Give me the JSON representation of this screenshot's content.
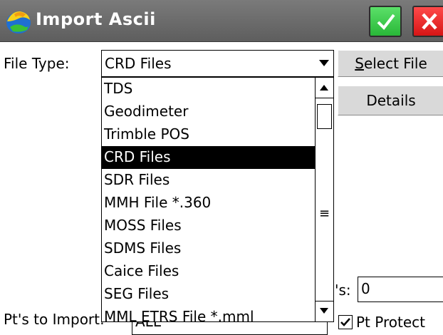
{
  "window": {
    "title": "Import Ascii"
  },
  "form": {
    "file_type_label": "File Type:",
    "file_type_value": "CRD Files",
    "select_file_prefix": "S",
    "select_file_rest": "elect File",
    "details_label": "Details",
    "pts_to_import_label": "Pt's to Import:",
    "pts_to_import_value": "ALL",
    "pts_field_label": "'s:",
    "pts_field_value": "0",
    "pt_protect_label": "Pt Protect",
    "pt_protect_checked": true
  },
  "dropdown": {
    "items": [
      "TDS",
      "Geodimeter",
      "Trimble POS",
      "CRD Files",
      "SDR Files",
      "MMH File *.360",
      "MOSS Files",
      "SDMS Files",
      "Caice Files",
      "SEG Files",
      "MML ETRS File *.mml"
    ],
    "selected_index": 3
  },
  "icons": {
    "app": "app-globe-icon",
    "ok": "checkmark-icon",
    "close": "close-icon"
  },
  "colors": {
    "title_bar": "#666666",
    "ok": "#2fc43d",
    "close": "#e01b1b",
    "selection": "#000000"
  }
}
